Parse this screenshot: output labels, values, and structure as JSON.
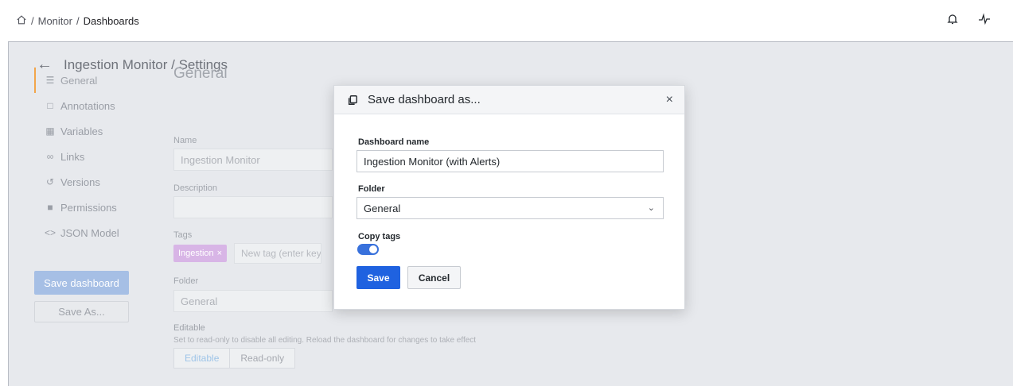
{
  "breadcrumb": {
    "home_icon": "home-icon",
    "items": [
      "Monitor",
      "Dashboards"
    ],
    "separator": "/"
  },
  "topbar": {
    "icons": [
      "bell-icon",
      "activity-icon"
    ]
  },
  "page": {
    "back_icon": "arrow-left-icon",
    "title": "Ingestion Monitor / Settings"
  },
  "sidebar": {
    "items": [
      {
        "label": "General",
        "icon": "sliders-icon",
        "active": true
      },
      {
        "label": "Annotations",
        "icon": "comment-icon"
      },
      {
        "label": "Variables",
        "icon": "variables-icon"
      },
      {
        "label": "Links",
        "icon": "link-icon"
      },
      {
        "label": "Versions",
        "icon": "history-icon"
      },
      {
        "label": "Permissions",
        "icon": "lock-icon"
      },
      {
        "label": "JSON Model",
        "icon": "code-icon"
      }
    ],
    "save_dashboard": "Save dashboard",
    "save_as": "Save As..."
  },
  "general": {
    "heading": "General",
    "name_label": "Name",
    "name_value": "Ingestion Monitor",
    "description_label": "Description",
    "description_value": "",
    "tags_label": "Tags",
    "tag": "Ingestion",
    "tag_remove": "×",
    "tag_placeholder": "New tag (enter key",
    "folder_label": "Folder",
    "folder_value": "General",
    "editable_label": "Editable",
    "editable_desc": "Set to read-only to disable all editing. Reload the dashboard for changes to take effect",
    "editable_options": [
      "Editable",
      "Read-only"
    ],
    "editable_selected": "Editable"
  },
  "modal": {
    "icon": "copy-icon",
    "title": "Save dashboard as...",
    "close": "×",
    "name_label": "Dashboard name",
    "name_value": "Ingestion Monitor (with Alerts)",
    "folder_label": "Folder",
    "folder_value": "General",
    "copy_tags_label": "Copy tags",
    "copy_tags_on": true,
    "save": "Save",
    "cancel": "Cancel"
  },
  "colors": {
    "primary": "#1f62e0",
    "toggle_on": "#3871dc",
    "active_accent": "#f2a54a",
    "tag": "#d8b5e6"
  }
}
